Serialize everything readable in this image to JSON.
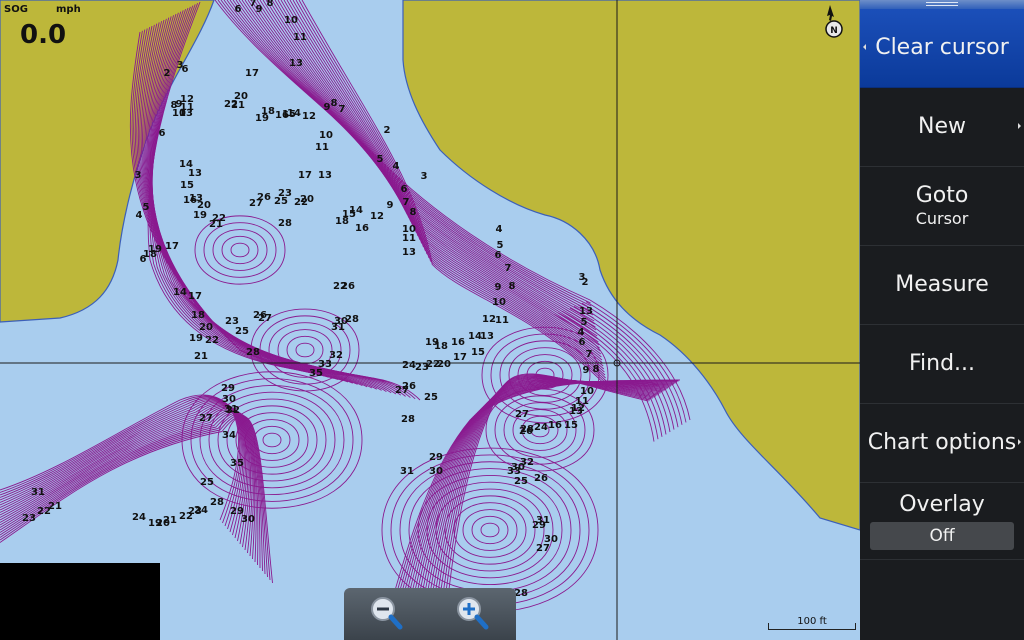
{
  "status": {
    "sog_label": "SOG",
    "sog_unit": "mph",
    "sog_value": "0.0"
  },
  "scale_label": "100 ft",
  "north_label": "N",
  "menu": {
    "clear_cursor": "Clear cursor",
    "new": "New",
    "goto": "Goto",
    "goto_sub": "Cursor",
    "measure": "Measure",
    "find": "Find...",
    "chart_options": "Chart options",
    "overlay": "Overlay",
    "overlay_value": "Off"
  },
  "depths": [
    {
      "t": "6"
    },
    {
      "t": "7"
    },
    {
      "t": "9"
    },
    {
      "t": "8"
    },
    {
      "t": "10"
    },
    {
      "t": "11"
    },
    {
      "t": "13"
    },
    {
      "t": "17"
    },
    {
      "t": "2"
    },
    {
      "t": "3"
    },
    {
      "t": "6"
    },
    {
      "t": "20"
    },
    {
      "t": "21"
    },
    {
      "t": "22"
    },
    {
      "t": "12"
    },
    {
      "t": "11"
    },
    {
      "t": "8"
    },
    {
      "t": "9"
    },
    {
      "t": "13"
    },
    {
      "t": "10"
    },
    {
      "t": "9"
    },
    {
      "t": "8"
    },
    {
      "t": "7"
    },
    {
      "t": "19"
    },
    {
      "t": "18"
    },
    {
      "t": "16"
    },
    {
      "t": "15"
    },
    {
      "t": "14"
    },
    {
      "t": "12"
    },
    {
      "t": "6"
    },
    {
      "t": "10"
    },
    {
      "t": "11"
    },
    {
      "t": "2"
    },
    {
      "t": "5"
    },
    {
      "t": "4"
    },
    {
      "t": "3"
    },
    {
      "t": "14"
    },
    {
      "t": "13"
    },
    {
      "t": "15"
    },
    {
      "t": "3"
    },
    {
      "t": "17"
    },
    {
      "t": "13"
    },
    {
      "t": "6"
    },
    {
      "t": "16"
    },
    {
      "t": "13"
    },
    {
      "t": "20"
    },
    {
      "t": "19"
    },
    {
      "t": "5"
    },
    {
      "t": "4"
    },
    {
      "t": "26"
    },
    {
      "t": "23"
    },
    {
      "t": "25"
    },
    {
      "t": "27"
    },
    {
      "t": "22"
    },
    {
      "t": "20"
    },
    {
      "t": "9"
    },
    {
      "t": "7"
    },
    {
      "t": "8"
    },
    {
      "t": "14"
    },
    {
      "t": "15"
    },
    {
      "t": "12"
    },
    {
      "t": "18"
    },
    {
      "t": "16"
    },
    {
      "t": "22"
    },
    {
      "t": "21"
    },
    {
      "t": "28"
    },
    {
      "t": "10"
    },
    {
      "t": "11"
    },
    {
      "t": "13"
    },
    {
      "t": "4"
    },
    {
      "t": "5"
    },
    {
      "t": "6"
    },
    {
      "t": "6"
    },
    {
      "t": "18"
    },
    {
      "t": "19"
    },
    {
      "t": "17"
    },
    {
      "t": "7"
    },
    {
      "t": "22"
    },
    {
      "t": "26"
    },
    {
      "t": "9"
    },
    {
      "t": "8"
    },
    {
      "t": "2"
    },
    {
      "t": "3"
    },
    {
      "t": "14"
    },
    {
      "t": "17"
    },
    {
      "t": "10"
    },
    {
      "t": "18"
    },
    {
      "t": "20"
    },
    {
      "t": "23"
    },
    {
      "t": "25"
    },
    {
      "t": "26"
    },
    {
      "t": "27"
    },
    {
      "t": "30"
    },
    {
      "t": "31"
    },
    {
      "t": "28"
    },
    {
      "t": "12"
    },
    {
      "t": "11"
    },
    {
      "t": "13"
    },
    {
      "t": "5"
    },
    {
      "t": "4"
    },
    {
      "t": "6"
    },
    {
      "t": "19"
    },
    {
      "t": "22"
    },
    {
      "t": "21"
    },
    {
      "t": "28"
    },
    {
      "t": "32"
    },
    {
      "t": "33"
    },
    {
      "t": "35"
    },
    {
      "t": "19"
    },
    {
      "t": "18"
    },
    {
      "t": "16"
    },
    {
      "t": "17"
    },
    {
      "t": "14"
    },
    {
      "t": "13"
    },
    {
      "t": "15"
    },
    {
      "t": "24"
    },
    {
      "t": "23"
    },
    {
      "t": "22"
    },
    {
      "t": "20"
    },
    {
      "t": "7"
    },
    {
      "t": "9"
    },
    {
      "t": "8"
    },
    {
      "t": "29"
    },
    {
      "t": "30"
    },
    {
      "t": "31"
    },
    {
      "t": "32"
    },
    {
      "t": "27"
    },
    {
      "t": "26"
    },
    {
      "t": "27"
    },
    {
      "t": "25"
    },
    {
      "t": "10"
    },
    {
      "t": "11"
    },
    {
      "t": "12"
    },
    {
      "t": "13"
    },
    {
      "t": "28"
    },
    {
      "t": "27"
    },
    {
      "t": "34"
    },
    {
      "t": "35"
    },
    {
      "t": "28"
    },
    {
      "t": "26"
    },
    {
      "t": "24"
    },
    {
      "t": "16"
    },
    {
      "t": "15"
    },
    {
      "t": "29"
    },
    {
      "t": "30"
    },
    {
      "t": "31"
    },
    {
      "t": "30"
    },
    {
      "t": "33"
    },
    {
      "t": "32"
    },
    {
      "t": "26"
    },
    {
      "t": "25"
    },
    {
      "t": "31"
    },
    {
      "t": "21"
    },
    {
      "t": "22"
    },
    {
      "t": "23"
    },
    {
      "t": "24"
    },
    {
      "t": "19"
    },
    {
      "t": "20"
    },
    {
      "t": "21"
    },
    {
      "t": "22"
    },
    {
      "t": "23"
    },
    {
      "t": "24"
    },
    {
      "t": "25"
    },
    {
      "t": "28"
    },
    {
      "t": "29"
    },
    {
      "t": "30"
    },
    {
      "t": "31"
    },
    {
      "t": "29"
    },
    {
      "t": "30"
    },
    {
      "t": "27"
    },
    {
      "t": "28"
    },
    {
      "t": "35"
    },
    {
      "t": "27"
    },
    {
      "t": "28"
    }
  ]
}
